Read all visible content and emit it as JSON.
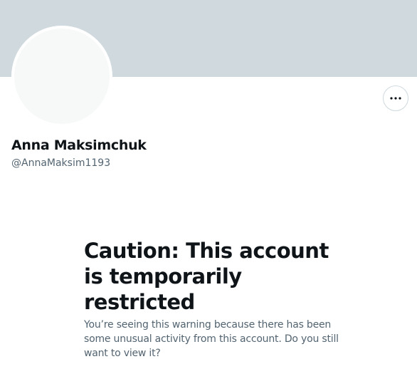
{
  "profile": {
    "banner_color": "#cfd9de",
    "avatar_color": "#f7f9f9",
    "display_name": "Anna Maksimchuk",
    "handle": "@AnnaMaksim1193",
    "more_icon": "ellipsis-horizontal-icon"
  },
  "notice": {
    "title": "Caution: This account is temporarily restricted",
    "body": "You’re seeing this warning because there has been some unusual activity from this account. Do you still want to view it?"
  },
  "colors": {
    "text_primary": "#0f1419",
    "text_secondary": "#536471",
    "border": "#cfd9de"
  }
}
